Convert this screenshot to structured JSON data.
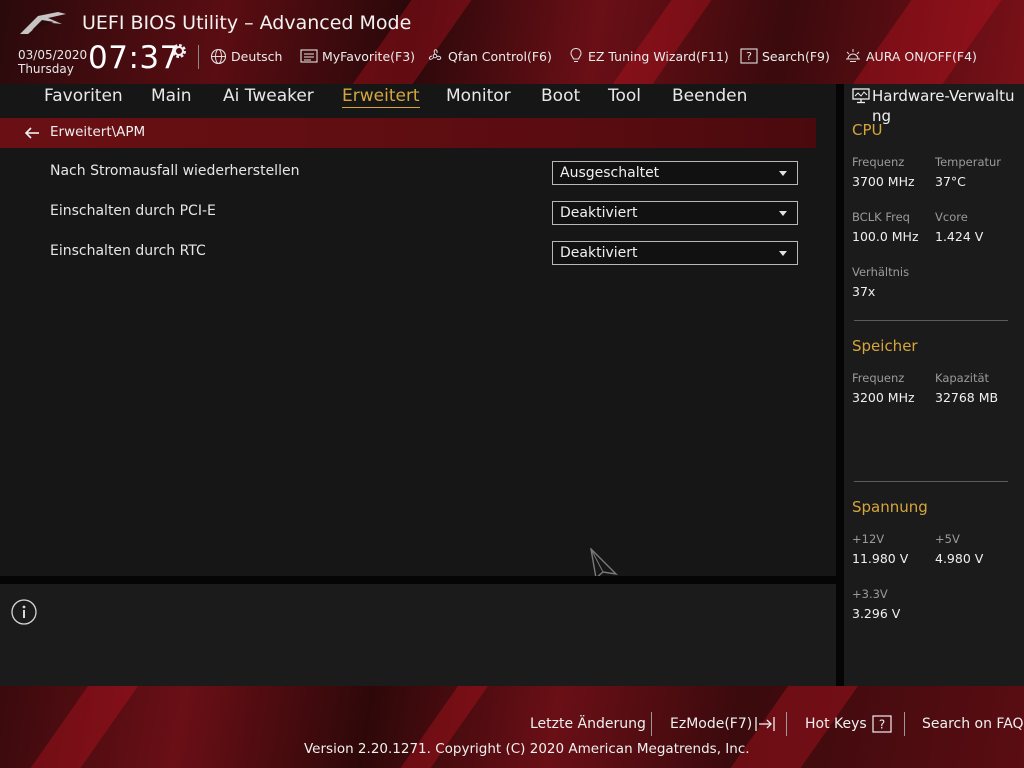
{
  "header": {
    "title": "UEFI BIOS Utility – Advanced Mode",
    "date": "03/05/2020",
    "day": "Thursday",
    "time": "07:37",
    "toolbar": {
      "language": "Deutsch",
      "myfavorite": "MyFavorite(F3)",
      "qfan": "Qfan Control(F6)",
      "ez_tuning": "EZ Tuning Wizard(F11)",
      "search": "Search(F9)",
      "aura": "AURA ON/OFF(F4)"
    }
  },
  "nav": {
    "tabs": [
      {
        "label": "Favoriten"
      },
      {
        "label": "Main"
      },
      {
        "label": "Ai Tweaker"
      },
      {
        "label": "Erweitert"
      },
      {
        "label": "Monitor"
      },
      {
        "label": "Boot"
      },
      {
        "label": "Tool"
      },
      {
        "label": "Beenden"
      }
    ],
    "active": "Erweitert"
  },
  "breadcrumb": "Erweitert\\APM",
  "options": [
    {
      "label": "Nach Stromausfall wiederherstellen",
      "value": "Ausgeschaltet"
    },
    {
      "label": "Einschalten durch PCI-E",
      "value": "Deaktiviert"
    },
    {
      "label": "Einschalten durch RTC",
      "value": "Deaktiviert"
    }
  ],
  "hw": {
    "title": "Hardware-Verwaltung",
    "cpu": {
      "heading": "CPU",
      "freq_label": "Frequenz",
      "freq": "3700 MHz",
      "temp_label": "Temperatur",
      "temp": "37°C",
      "bclk_label": "BCLK Freq",
      "bclk": "100.0 MHz",
      "vcore_label": "Vcore",
      "vcore": "1.424 V",
      "ratio_label": "Verhältnis",
      "ratio": "37x"
    },
    "memory": {
      "heading": "Speicher",
      "freq_label": "Frequenz",
      "freq": "3200 MHz",
      "cap_label": "Kapazität",
      "cap": "32768 MB"
    },
    "voltage": {
      "heading": "Spannung",
      "v12_label": "+12V",
      "v12": "11.980 V",
      "v5_label": "+5V",
      "v5": "4.980 V",
      "v33_label": "+3.3V",
      "v33": "3.296 V"
    }
  },
  "footer": {
    "last_change": "Letzte Änderung",
    "ezmode": "EzMode(F7)",
    "hotkeys": "Hot Keys",
    "faq": "Search on FAQ",
    "copyright": "Version 2.20.1271. Copyright (C) 2020 American Megatrends, Inc."
  },
  "colors": {
    "accent": "#d6a63b",
    "brand_red": "#6a1014"
  }
}
